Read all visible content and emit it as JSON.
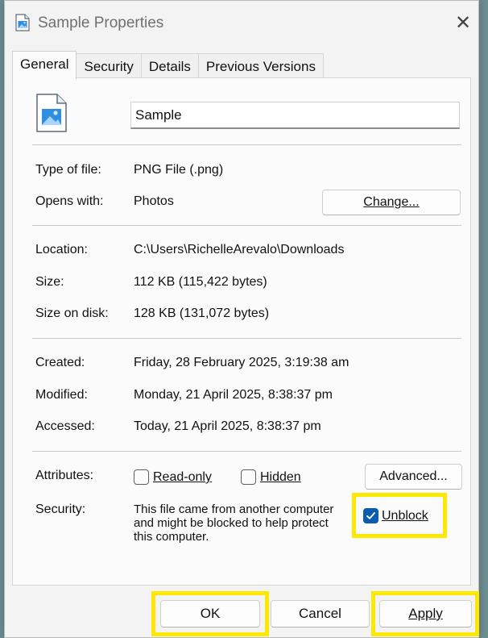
{
  "window": {
    "title": "Sample Properties",
    "close_glyph": "✕"
  },
  "tabs": [
    {
      "label": "General",
      "active": true
    },
    {
      "label": "Security",
      "active": false
    },
    {
      "label": "Details",
      "active": false
    },
    {
      "label": "Previous Versions",
      "active": false
    }
  ],
  "file": {
    "name": "Sample",
    "icon": "image-file-icon"
  },
  "info": {
    "type_label": "Type of file:",
    "type_value": "PNG File (.png)",
    "opens_label": "Opens with:",
    "opens_value": "Photos",
    "change_button": "Change...",
    "location_label": "Location:",
    "location_value": "C:\\Users\\RichelleArevalo\\Downloads",
    "size_label": "Size:",
    "size_value": "112 KB (115,422 bytes)",
    "size_disk_label": "Size on disk:",
    "size_disk_value": "128 KB (131,072 bytes)",
    "created_label": "Created:",
    "created_value": "Friday, 28 February 2025, 3:19:38 am",
    "modified_label": "Modified:",
    "modified_value": "Monday, 21 April 2025, 8:38:37 pm",
    "accessed_label": "Accessed:",
    "accessed_value": "Today, 21 April 2025, 8:38:37 pm"
  },
  "attributes": {
    "label": "Attributes:",
    "readonly_label": "Read-only",
    "readonly_checked": false,
    "hidden_label": "Hidden",
    "hidden_checked": false,
    "advanced_button": "Advanced..."
  },
  "security": {
    "label": "Security:",
    "line1": "This file came from another computer",
    "line2": "and might be blocked to help protect",
    "line3": "this computer.",
    "unblock_label": "Unblock",
    "unblock_checked": true
  },
  "footer": {
    "ok": "OK",
    "cancel": "Cancel",
    "apply": "Apply"
  },
  "colors": {
    "highlight": "#ffe800",
    "accent": "#0b5cad"
  }
}
